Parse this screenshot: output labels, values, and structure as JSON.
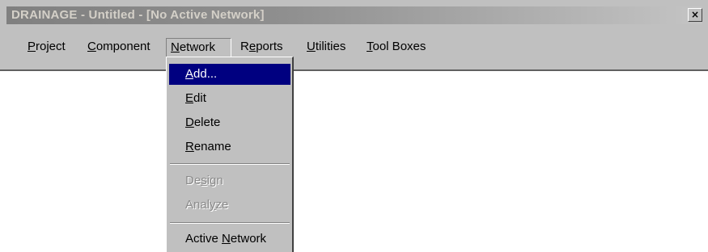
{
  "window": {
    "title": "DRAINAGE - Untitled - [No Active Network]",
    "close_glyph": "×"
  },
  "menubar": {
    "items": [
      {
        "mnemonic": "P",
        "rest": "roject"
      },
      {
        "mnemonic": "C",
        "rest": "omponent"
      },
      {
        "mnemonic": "N",
        "rest": "etwork"
      },
      {
        "pre": "R",
        "mnemonic": "e",
        "rest": "ports"
      },
      {
        "mnemonic": "U",
        "rest": "tilities"
      },
      {
        "mnemonic": "T",
        "rest": "ool Boxes"
      }
    ]
  },
  "network_menu": {
    "items": [
      {
        "pre": "",
        "mnemonic": "A",
        "rest": "dd...",
        "state": "highlighted"
      },
      {
        "pre": "",
        "mnemonic": "E",
        "rest": "dit",
        "state": "enabled"
      },
      {
        "pre": "",
        "mnemonic": "D",
        "rest": "elete",
        "state": "enabled"
      },
      {
        "pre": "",
        "mnemonic": "R",
        "rest": "ename",
        "state": "enabled"
      },
      {
        "pre": "De",
        "mnemonic": "s",
        "rest": "ign",
        "state": "disabled"
      },
      {
        "pre": "Anal",
        "mnemonic": "y",
        "rest": "ze",
        "state": "disabled"
      },
      {
        "pre": "Active ",
        "mnemonic": "N",
        "rest": "etwork",
        "state": "enabled"
      }
    ]
  },
  "colors": {
    "face": "#c0c0c0",
    "highlight": "#000080",
    "disabled_text": "#8a8a8a"
  },
  "icons": [
    "close-icon"
  ]
}
